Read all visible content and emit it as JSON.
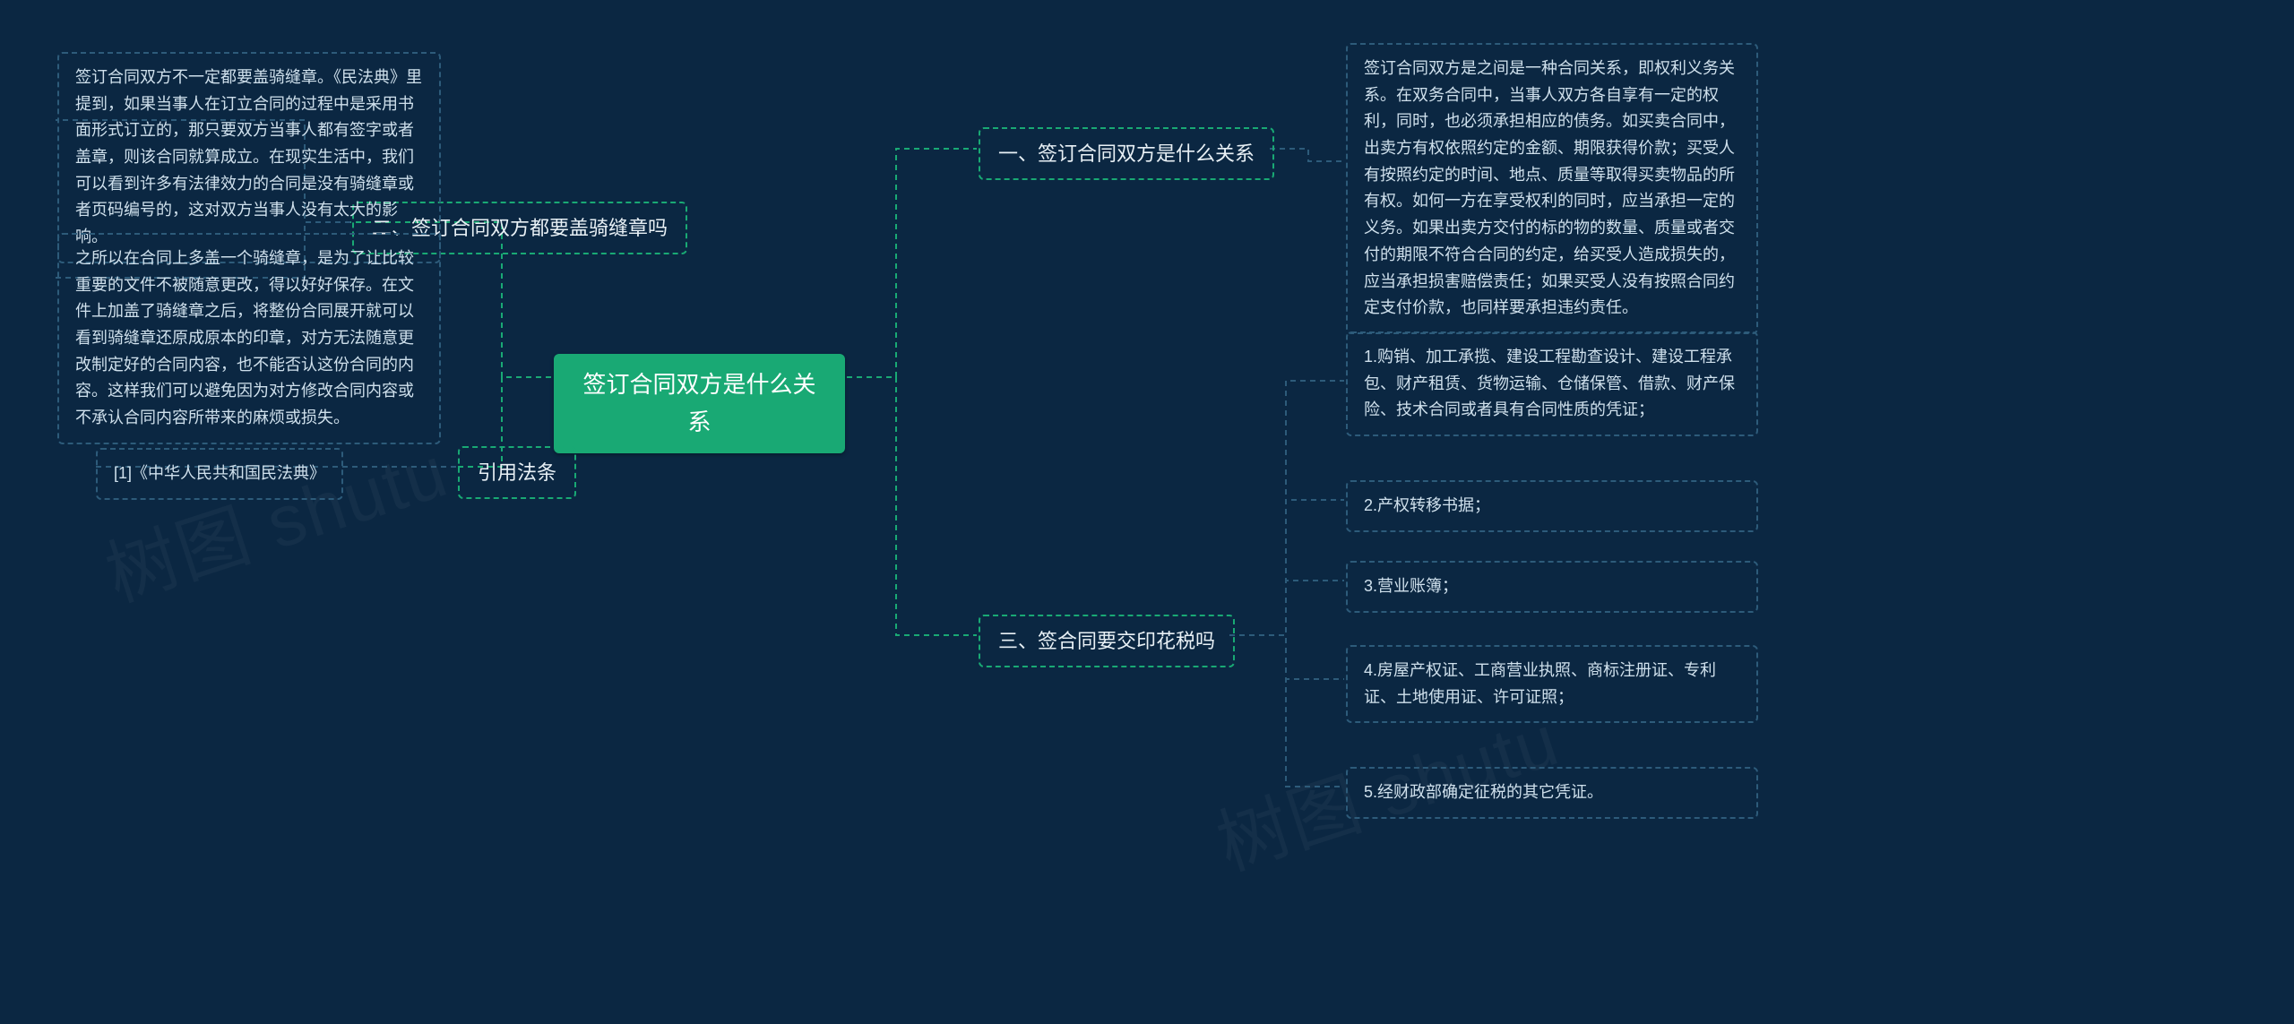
{
  "root": {
    "label": "签订合同双方是什么关系"
  },
  "right": {
    "b1": {
      "label": "一、签订合同双方是什么关系",
      "leaves": [
        "签订合同双方是之间是一种合同关系，即权利义务关系。在双务合同中，当事人双方各自享有一定的权利，同时，也必须承担相应的债务。如买卖合同中，出卖方有权依照约定的金额、期限获得价款；买受人有按照约定的时间、地点、质量等取得买卖物品的所有权。如何一方在享受权利的同时，应当承担一定的义务。如果出卖方交付的标的物的数量、质量或者交付的期限不符合合同的约定，给买受人造成损失的，应当承担损害赔偿责任；如果买受人没有按照合同约定支付价款，也同样要承担违约责任。"
      ]
    },
    "b3": {
      "label": "三、签合同要交印花税吗",
      "leaves": [
        "1.购销、加工承揽、建设工程勘查设计、建设工程承包、财产租赁、货物运输、仓储保管、借款、财产保险、技术合同或者具有合同性质的凭证；",
        "2.产权转移书据；",
        "3.营业账簿；",
        "4.房屋产权证、工商营业执照、商标注册证、专利证、土地使用证、许可证照；",
        "5.经财政部确定征税的其它凭证。"
      ]
    }
  },
  "left": {
    "b2": {
      "label": "二、签订合同双方都要盖骑缝章吗",
      "leaves": [
        "签订合同双方不一定都要盖骑缝章。《民法典》里提到，如果当事人在订立合同的过程中是采用书面形式订立的，那只要双方当事人都有签字或者盖章，则该合同就算成立。在现实生活中，我们可以看到许多有法律效力的合同是没有骑缝章或者页码编号的，这对双方当事人没有太大的影响。",
        "之所以在合同上多盖一个骑缝章，是为了让比较重要的文件不被随意更改，得以好好保存。在文件上加盖了骑缝章之后，将整份合同展开就可以看到骑缝章还原成原本的印章，对方无法随意更改制定好的合同内容，也不能否认这份合同的内容。这样我们可以避免因为对方修改合同内容或不承认合同内容所带来的麻烦或损失。"
      ]
    },
    "b4": {
      "label": "引用法条",
      "leaves": [
        "[1]《中华人民共和国民法典》"
      ]
    }
  },
  "watermark": "树图 shutu"
}
